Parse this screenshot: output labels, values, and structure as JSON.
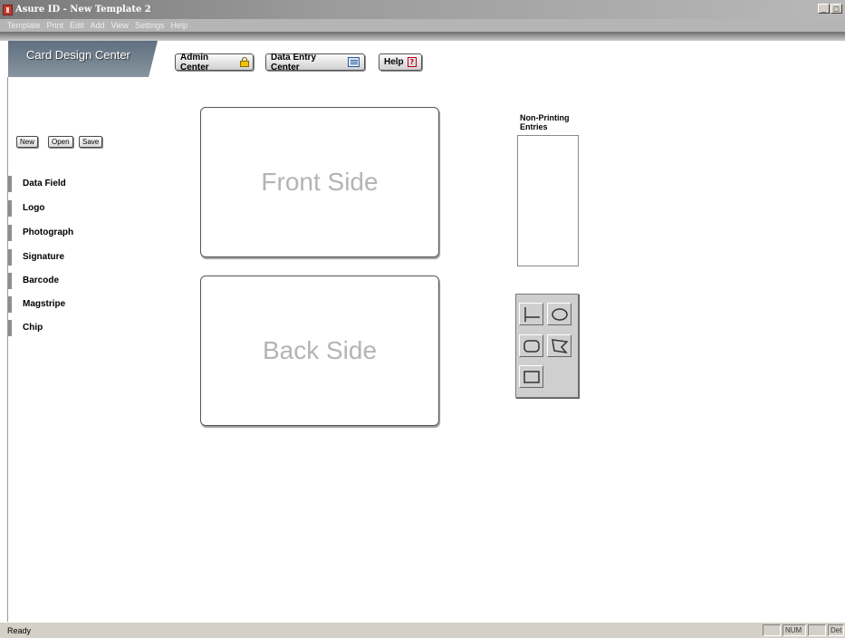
{
  "window": {
    "title": "Asure ID - New Template 2"
  },
  "menu": [
    "Template",
    "Print",
    "Edit",
    "Add",
    "View",
    "Settings",
    "Help"
  ],
  "header": {
    "title": "Card Design Center",
    "buttons": {
      "admin": "Admin Center",
      "data_entry": "Data Entry Center",
      "help": "Help"
    }
  },
  "file_buttons": {
    "new": "New",
    "open": "Open",
    "save": "Save"
  },
  "sidebar": {
    "items": [
      {
        "label": "Data Field"
      },
      {
        "label": "Logo"
      },
      {
        "label": "Photograph"
      },
      {
        "label": "Signature"
      },
      {
        "label": "Barcode"
      },
      {
        "label": "Magstripe"
      },
      {
        "label": "Chip"
      }
    ]
  },
  "cards": {
    "front": "Front Side",
    "back": "Back Side"
  },
  "non_printing": {
    "label_line1": "Non-Printing",
    "label_line2": "Entries"
  },
  "tools": [
    "line-tool-icon",
    "ellipse-tool-icon",
    "rounded-rectangle-tool-icon",
    "polygon-tool-icon",
    "rectangle-tool-icon"
  ],
  "status": {
    "text": "Ready",
    "num": "NUM",
    "ovr": "Det"
  },
  "colors": {
    "title_tab": "#6f7d8b",
    "card_text": "#b4b4b4",
    "background": "#ffffff"
  }
}
